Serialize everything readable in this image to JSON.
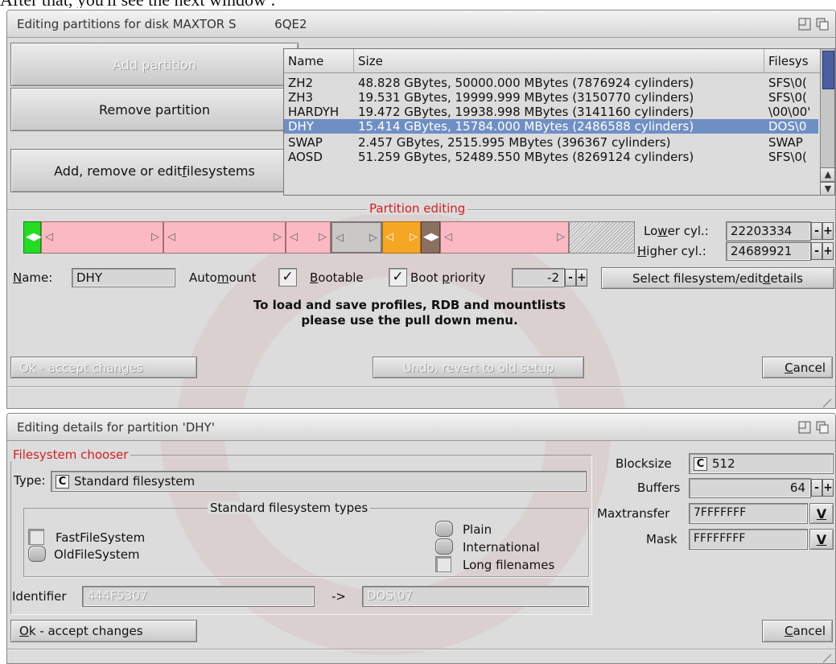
{
  "caption": "After that, you'll see the next window :",
  "win1": {
    "title": "Editing partitions for disk MAXTOR S          6QE2",
    "buttons": {
      "add_partition": "Add partition",
      "remove_partition": "Remove partition",
      "edit_filesystems_pre": "Add, remove or edit ",
      "edit_filesystems_key": "f",
      "edit_filesystems_post": "ilesystems"
    },
    "table": {
      "columns": [
        "Name",
        "Size",
        "Filesys"
      ],
      "rows": [
        {
          "name": "ZH2",
          "size": "48.828 GBytes, 50000.000 MBytes (7876924 cylinders)",
          "fs": "SFS\\0("
        },
        {
          "name": "ZH3",
          "size": "19.531 GBytes, 19999.999 MBytes (3150770 cylinders)",
          "fs": "SFS\\0("
        },
        {
          "name": "HARDYH",
          "size": "19.472 GBytes, 19938.998 MBytes (3141160 cylinders)",
          "fs": "\\00\\00'"
        },
        {
          "name": "DHY",
          "size": "15.414 GBytes, 15784.000 MBytes (2486588 cylinders)",
          "fs": "DOS\\0"
        },
        {
          "name": "SWAP",
          "size": "2.457 GBytes, 2515.995 MBytes (396367 cylinders)",
          "fs": "SWAP"
        },
        {
          "name": "AOSD",
          "size": "51.259 GBytes, 52489.550 MBytes (8269124 cylinders)",
          "fs": "SFS\\0("
        }
      ],
      "selected_row": "DHY"
    },
    "editing_group": "Partition editing",
    "lower_cyl_pre": "Lo",
    "lower_cyl_key": "w",
    "lower_cyl_post": "er cyl.:",
    "lower_cyl_value": "22203334",
    "higher_cyl_key": "H",
    "higher_cyl_post": "igher cyl.:",
    "higher_cyl_value": "24689921",
    "name_key": "N",
    "name_post": "ame:",
    "name_value": "DHY",
    "automount_pre": "Auto",
    "automount_key": "m",
    "automount_post": "ount",
    "bootable_key": "B",
    "bootable_post": "ootable",
    "boot_priority_pre": "Boot ",
    "boot_priority_key": "p",
    "boot_priority_post": "riority",
    "boot_priority_value": "-2",
    "select_fs_pre": "Select filesystem/edit ",
    "select_fs_key": "d",
    "select_fs_post": "etails",
    "hint_line1": "To load and save profiles, RDB and mountlists",
    "hint_line2": "please use the pull down menu.",
    "ok_label": "Ok - accept changes",
    "undo_label": "Undo, revert to old setup",
    "cancel_key": "C",
    "cancel_post": "ancel",
    "check_mark": "✓",
    "plus": "+",
    "minus": "-"
  },
  "win2": {
    "title": "Editing details for partition 'DHY'",
    "fs_chooser": "Filesystem chooser",
    "type_label": "Type:",
    "type_value": "Standard filesystem",
    "std_types": "Standard filesystem types",
    "fastfs": "FastFileSystem",
    "oldfs": "OldFileSystem",
    "plain": "Plain",
    "international": "International",
    "long_filenames": "Long filenames",
    "identifier_label": "Identifier",
    "identifier_value": "444F5307",
    "arrow": "->",
    "identifier_dos": "DOS\\07",
    "blocksize_label": "Blocksize",
    "blocksize_value": "512",
    "buffers_label": "Buffers",
    "buffers_value": "64",
    "maxtransfer_label": "Maxtransfer",
    "maxtransfer_value": "7FFFFFFF",
    "mask_label": "Mask",
    "mask_value": "FFFFFFFF",
    "ok_key": "O",
    "ok_post": "k - accept changes",
    "cancel_key": "C",
    "cancel_post": "ancel",
    "cycle_glyph": "C",
    "v_glyph": "V",
    "plus": "+",
    "minus": "-"
  },
  "colors": {
    "selected_row": "#6f8fc4",
    "segment_pink": "#fbb9c3",
    "segment_green": "#22dd22",
    "segment_orange": "#f5a623",
    "segment_brown": "#8a7060",
    "label_red": "#d42020"
  },
  "icons": [
    "zoom-icon",
    "depth-icon",
    "cycle-icon",
    "popup-v-icon",
    "check-icon",
    "resize-icon"
  ]
}
